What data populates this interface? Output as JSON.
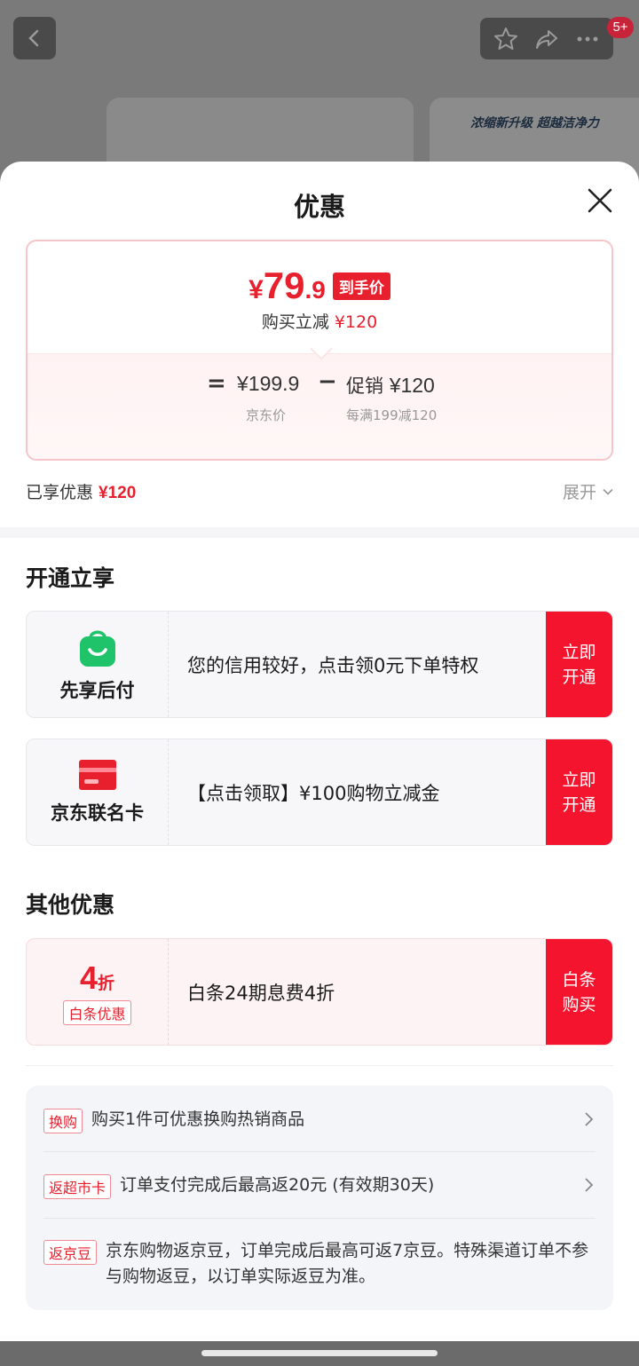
{
  "background": {
    "badge": "5+",
    "promo_banner": "浓缩新升级 超越洁净力"
  },
  "sheet": {
    "title": "优惠"
  },
  "price_card": {
    "currency": "¥",
    "final_int": "79",
    "final_dec": ".9",
    "final_tag": "到手价",
    "reduce_label": "购买立减",
    "reduce_amount": "¥120",
    "eq": "=",
    "jd_price": "¥199.9",
    "jd_label": "京东价",
    "minus": "−",
    "promo_label": "促销",
    "promo_amount": "¥120",
    "promo_desc": "每满199减120"
  },
  "enjoyed": {
    "label": "已享优惠",
    "amount": "¥120",
    "expand": "展开"
  },
  "section_open": {
    "title": "开通立享",
    "offers": [
      {
        "name": "先享后付",
        "text": "您的信用较好，点击领0元下单特权",
        "button": "立即开通"
      },
      {
        "name": "京东联名卡",
        "text": "【点击领取】¥100购物立减金",
        "button": "立即开通"
      }
    ]
  },
  "section_other": {
    "title": "其他优惠",
    "offer": {
      "discount_num": "4",
      "discount_unit": "折",
      "tag": "白条优惠",
      "text": "白条24期息费4折",
      "button": "白条购买"
    }
  },
  "perks": [
    {
      "tag": "换购",
      "text": "购买1件可优惠换购热销商品"
    },
    {
      "tag": "返超市卡",
      "text": "订单支付完成后最高返20元 (有效期30天)"
    },
    {
      "tag": "返京豆",
      "text": "京东购物返京豆，订单完成后最高可返7京豆。特殊渠道订单不参与购物返豆，以订单实际返豆为准。"
    }
  ],
  "colors": {
    "accent_red": "#e8202e",
    "button_red": "#f5142d",
    "app_green": "#1fc46a"
  }
}
